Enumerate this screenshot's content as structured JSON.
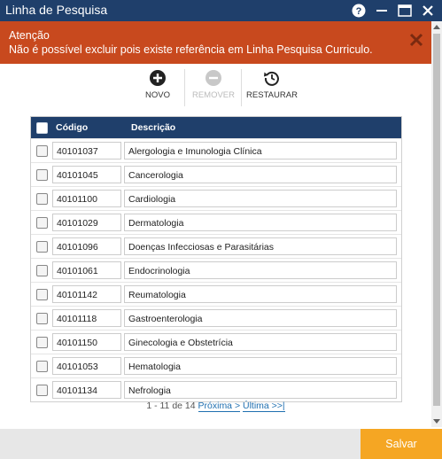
{
  "window": {
    "title": "Linha de Pesquisa",
    "icons": [
      "help-icon",
      "minimize-icon",
      "maximize-icon",
      "close-icon"
    ]
  },
  "alert": {
    "title": "Atenção",
    "message": "Não é possível excluir pois existe referência em Linha Pesquisa Curriculo.",
    "color": "#c8491e"
  },
  "toolbar": {
    "novo": "NOVO",
    "remover": "REMOVER",
    "restaurar": "RESTAURAR"
  },
  "table": {
    "headers": {
      "codigo": "Código",
      "descricao": "Descrição"
    },
    "rows": [
      {
        "codigo": "40101037",
        "descricao": "Alergologia e Imunologia Clínica"
      },
      {
        "codigo": "40101045",
        "descricao": "Cancerologia"
      },
      {
        "codigo": "40101100",
        "descricao": "Cardiologia"
      },
      {
        "codigo": "40101029",
        "descricao": "Dermatologia"
      },
      {
        "codigo": "40101096",
        "descricao": "Doenças Infecciosas e Parasitárias"
      },
      {
        "codigo": "40101061",
        "descricao": "Endocrinologia"
      },
      {
        "codigo": "40101142",
        "descricao": "Reumatologia"
      },
      {
        "codigo": "40101118",
        "descricao": "Gastroenterologia"
      },
      {
        "codigo": "40101150",
        "descricao": "Ginecologia e Obstetrícia"
      },
      {
        "codigo": "40101053",
        "descricao": "Hematologia"
      },
      {
        "codigo": "40101134",
        "descricao": "Nefrologia"
      }
    ]
  },
  "pager": {
    "summary": "1 - 11 de 14",
    "next": "Próxima >",
    "last": "Última >>|"
  },
  "footer": {
    "save": "Salvar"
  },
  "colors": {
    "header": "#1f3f6b",
    "accent": "#f5a623"
  }
}
